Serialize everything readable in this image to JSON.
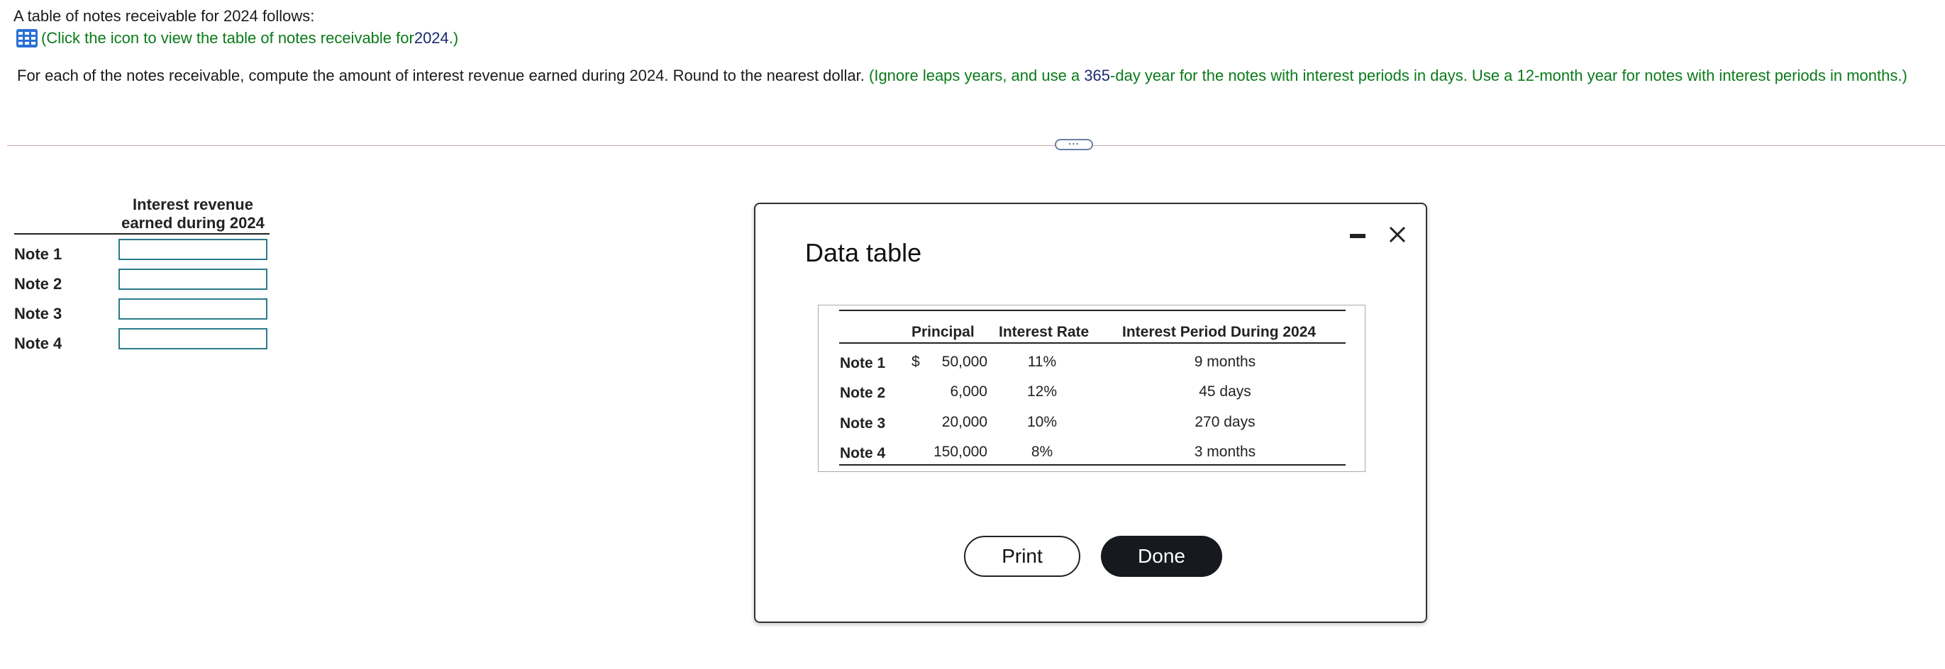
{
  "intro": "A table of notes receivable for 2024 follows:",
  "hint": {
    "icon": "table-grid-icon",
    "open_paren": "(",
    "text_before": "Click the icon to view the table of notes receivable for ",
    "year": "2024",
    "text_after": ".)",
    "color": "#0a7a1a"
  },
  "instructions": {
    "main": "For each of the notes receivable, compute the amount of interest revenue earned during 2024. Round to the nearest dollar. ",
    "note_before": "(Ignore leaps years, and use a ",
    "days": "365",
    "note_after": "-day year for the notes with interest periods in days. Use a 12-month year for notes with interest periods in months.)"
  },
  "divider_handle": "⋯",
  "answer": {
    "header_line1": "Interest revenue",
    "header_line2": "earned during 2024",
    "rows": [
      {
        "label": "Note 1",
        "value": ""
      },
      {
        "label": "Note 2",
        "value": ""
      },
      {
        "label": "Note 3",
        "value": ""
      },
      {
        "label": "Note 4",
        "value": ""
      }
    ]
  },
  "modal": {
    "title": "Data table",
    "columns": [
      "Principal",
      "Interest Rate",
      "Interest Period During 2024"
    ],
    "currency_symbol": "$",
    "rows": [
      {
        "label": "Note 1",
        "principal": "50,000",
        "rate": "11%",
        "period": "9 months"
      },
      {
        "label": "Note 2",
        "principal": "6,000",
        "rate": "12%",
        "period": "45 days"
      },
      {
        "label": "Note 3",
        "principal": "20,000",
        "rate": "10%",
        "period": "270 days"
      },
      {
        "label": "Note 4",
        "principal": "150,000",
        "rate": "8%",
        "period": "3 months"
      }
    ],
    "print_label": "Print",
    "done_label": "Done"
  }
}
